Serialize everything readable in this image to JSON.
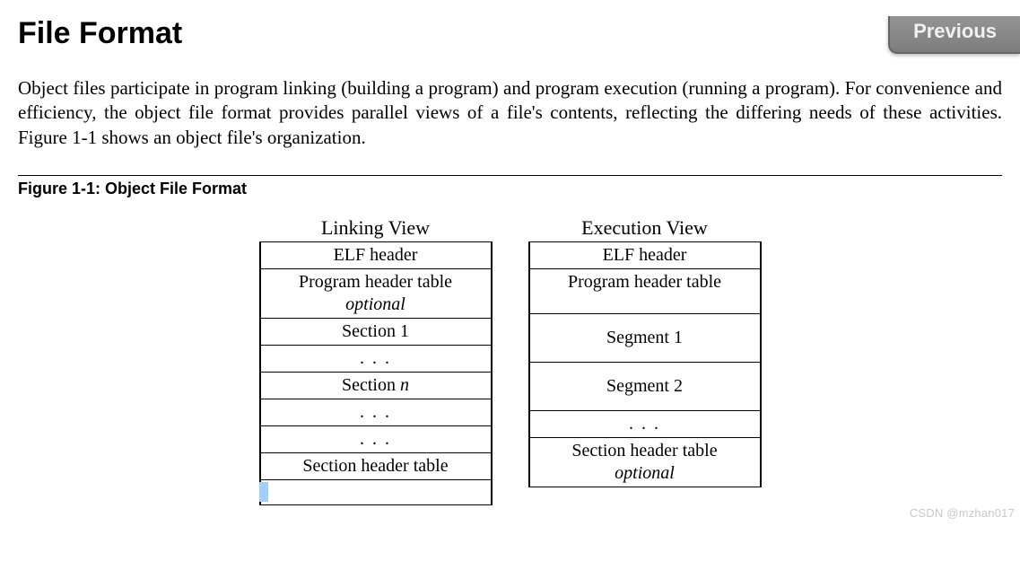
{
  "nav": {
    "previous_label": "Previous"
  },
  "heading": "File Format",
  "paragraph": "Object files participate in program linking (building a program) and program execution (running a program).  For convenience and efficiency, the object file format provides parallel views of a file's contents, reflecting the differing needs of these activities.  Figure 1-1 shows an object file's organization.",
  "figure": {
    "caption": "Figure 1-1:  Object File Format",
    "linking": {
      "title": "Linking View",
      "rows": {
        "elf_header": "ELF header",
        "pht": "Program header table",
        "pht_optional": "optional",
        "section1": "Section 1",
        "dots1": ". . .",
        "section_n_prefix": "Section ",
        "section_n_var": "n",
        "dots2": ". . .",
        "dots3": ". . .",
        "sht": "Section header table"
      }
    },
    "execution": {
      "title": "Execution View",
      "rows": {
        "elf_header": "ELF header",
        "pht": "Program header table",
        "seg1": "Segment 1",
        "seg2": "Segment 2",
        "dots": ". . .",
        "sht": "Section header table",
        "sht_optional": "optional"
      }
    }
  },
  "watermark": "CSDN @mzhan017"
}
